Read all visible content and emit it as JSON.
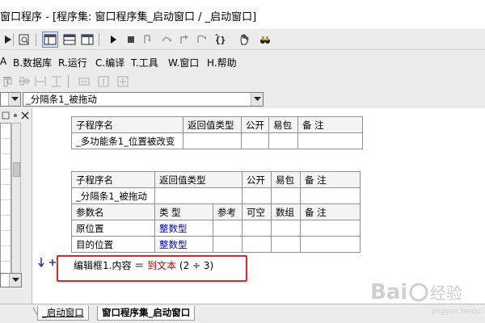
{
  "window": {
    "title": "窗口程序 - [程序集: 窗口程序集_启动窗口 / _启动窗口]"
  },
  "menubar": {
    "items": [
      {
        "key": "A",
        "label": "A"
      },
      {
        "key": "B",
        "label": "B.数据库"
      },
      {
        "key": "R",
        "label": "R.运行"
      },
      {
        "key": "C",
        "label": "C.编译"
      },
      {
        "key": "T",
        "label": "T.工具"
      },
      {
        "key": "W",
        "label": "W.窗口"
      },
      {
        "key": "H",
        "label": "H.帮助"
      }
    ]
  },
  "toolbar": {
    "icons": [
      "arrow-icon",
      "find-icon",
      "layout-1-icon",
      "layout-2-icon",
      "layout-3-icon",
      "run-icon",
      "stop-icon",
      "step-into-icon",
      "step-over-icon",
      "step-out-icon",
      "run-to-cursor-icon",
      "braces-icon",
      "hand-icon",
      "binoculars-icon"
    ]
  },
  "combobar": {
    "left_value": "",
    "right_value": "_分隔条1_被拖动"
  },
  "table1": {
    "headers": [
      "子程序名",
      "返回值类型",
      "公开",
      "易包",
      "备 注"
    ],
    "row": [
      "_多功能条1_位置被改变",
      "",
      "",
      "",
      ""
    ]
  },
  "table2": {
    "headers": [
      "子程序名",
      "返回值类型",
      "公开",
      "易包",
      "备 注"
    ],
    "row": [
      "_分隔条1_被拖动",
      "",
      "",
      "",
      ""
    ],
    "param_headers": [
      "参数名",
      "类 型",
      "参考",
      "可空",
      "数组",
      "备 注"
    ],
    "params": [
      {
        "name": "原位置",
        "type": "整数型"
      },
      {
        "name": "目的位置",
        "type": "整数型"
      }
    ]
  },
  "code": {
    "lhs": "编辑框1.内容 ＝ ",
    "func": "到文本",
    "args": " (2 ÷ 3)"
  },
  "tabs": [
    {
      "label": "_启动窗口",
      "active": false
    },
    {
      "label": "窗口程序集_启动窗口",
      "active": true
    }
  ],
  "colors": {
    "accent_red": "#e32424",
    "type_blue": "#0000cc"
  }
}
